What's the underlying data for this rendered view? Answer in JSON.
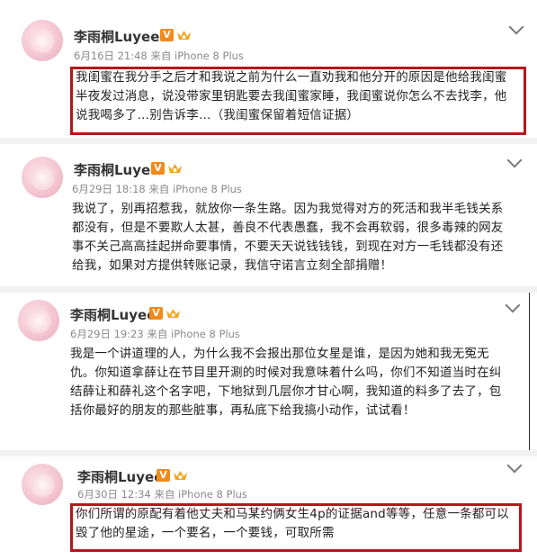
{
  "posts": [
    {
      "username": "李雨桐Luyee",
      "verified_badge": "V",
      "meta": "6月16日 21:48 来自 iPhone 8 Plus",
      "text": "我闺蜜在我分手之后才和我说之前为什么一直劝我和他分开的原因是他给我闺蜜\n半夜发过消息，说没带家里钥匙要去我闺蜜家睡，我闺蜜说你怎么不去找李，他\n说我喝多了…别告诉李…（我闺蜜保留着短信证据）",
      "highlighted": true
    },
    {
      "username": "李雨桐Luyee",
      "verified_badge": "V",
      "meta": "6月29日 18:18 来自 iPhone 8 Plus",
      "text": "我说了，别再招惹我，就放你一条生路。因为我觉得对方的死活和我半毛钱关系\n都没有，但是不要欺人太甚，善良不代表愚蠢，我不会再软弱，很多毒辣的网友\n事不关己高高挂起拼命要事情，不要天天说钱钱钱，到现在对方一毛钱都没有还\n给我，如果对方提供转账记录，我信守诺言立刻全部捐赠！",
      "highlighted": false
    },
    {
      "username": "李雨桐Luyee",
      "verified_badge": "V",
      "meta": "6月29日 19:23 来自 iPhone 8 Plus",
      "text": "我是一个讲道理的人，为什么我不会报出那位女星是谁，是因为她和我无冤无\n仇。你知道拿薛让在节目里开涮的时候对我意味着什么吗，你们不知道当时在纠\n结薛让和薛礼这个名字吧，下地狱到几层你才甘心啊，我知道的料多了去了，包\n括你最好的朋友的那些脏事，再私底下给我搞小动作，试试看！",
      "highlighted": false
    },
    {
      "username": "李雨桐Luyee",
      "verified_badge": "V",
      "meta": "6月30日 12:34 来自 iPhone 8 Plus",
      "text": "你们所谓的原配有着他丈夫和马某约俩女生4p的证据and等等，任意一条都可以\n毁了他的星途，一个要名，一个要钱，可取所需",
      "highlighted": true
    }
  ],
  "colors": {
    "highlight_border": "#b8151b",
    "vip_badge": "#f08a1c",
    "meta_text": "#8a8a8a"
  },
  "icons": {
    "menu": "chevron-down-icon",
    "vip": "crown-icon"
  }
}
